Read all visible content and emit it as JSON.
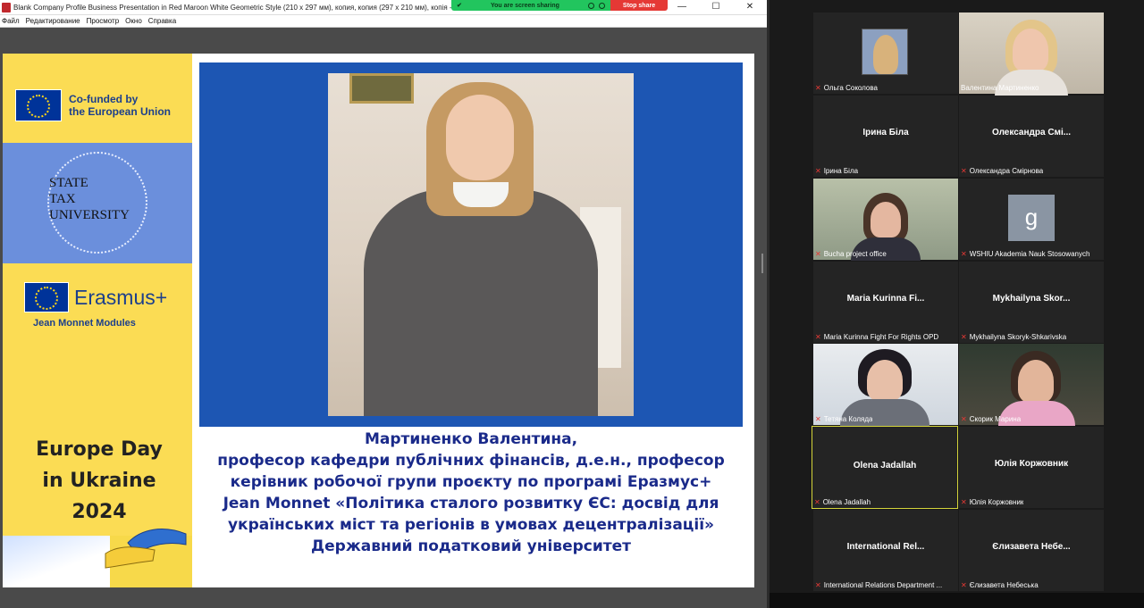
{
  "app": {
    "window_title": "Blank Company Profile Business Presentation in Red Maroon White Geometric Style (210 x 297 мм), копия, копия (297 x 210 мм), копія - А",
    "menu": [
      "Файл",
      "Редактирование",
      "Просмотр",
      "Окно",
      "Справка"
    ],
    "controls": {
      "minimize": "—",
      "maximize": "☐",
      "close": "✕"
    }
  },
  "screen_share": {
    "status_text": "You are screen sharing",
    "stop_label": "Stop share"
  },
  "slide": {
    "eu_cofunded": [
      "Co-funded by",
      "the European Union"
    ],
    "university_logo_text": [
      "STATE",
      "TAX",
      "UNIVERSITY"
    ],
    "erasmus_name": "Erasmus+",
    "erasmus_sub": "Jean Monnet Modules",
    "event": [
      "Europe Day",
      "in Ukraine",
      "2024"
    ],
    "caption_lines": [
      "Мартиненко Валентина,",
      "професор кафедри публічних фінансів, д.е.н., професор",
      "керівник робочої групи проєкту по програмі Еразмус+",
      "Jean Monnet «Політика сталого розвитку ЄС: досвід для",
      "українських міст та регіонів в умовах децентралізації»",
      "Державний податковий університет"
    ]
  },
  "gallery": {
    "tiles": [
      {
        "label": "Ольга Соколова",
        "center": "",
        "kind": "photo"
      },
      {
        "label": "Валентина Мартиненко",
        "center": "",
        "kind": "video-blonde"
      },
      {
        "label": "Ірина Біла",
        "center": "Ірина Біла",
        "kind": "name"
      },
      {
        "label": "Олександра Смірнова",
        "center": "Олександра Смі...",
        "kind": "name"
      },
      {
        "label": "Bucha project office",
        "center": "",
        "kind": "video-glasses"
      },
      {
        "label": "WSHIU Akademia Nauk Stosowanych",
        "center": "",
        "kind": "avatar",
        "avatar_letter": "g"
      },
      {
        "label": "Maria Kurinna Fight For Rights OPD",
        "center": "Maria Kurinna Fi...",
        "kind": "name"
      },
      {
        "label": "Mykhailyna Skoryk-Shkarivska",
        "center": "Mykhailyna Skor...",
        "kind": "name"
      },
      {
        "label": "Тетяна Коляда",
        "center": "",
        "kind": "video-dark"
      },
      {
        "label": "Скорик Марина",
        "center": "",
        "kind": "video-pink"
      },
      {
        "label": "Olena Jadallah",
        "center": "Olena Jadallah",
        "kind": "name",
        "active": true
      },
      {
        "label": "Юлія Коржовник",
        "center": "Юлія Коржовник",
        "kind": "name"
      },
      {
        "label": "International Relations Department ...",
        "center": "International Rel...",
        "kind": "name"
      },
      {
        "label": "Єлизавета Небеська",
        "center": "Єлизавета Небе...",
        "kind": "name"
      }
    ]
  }
}
